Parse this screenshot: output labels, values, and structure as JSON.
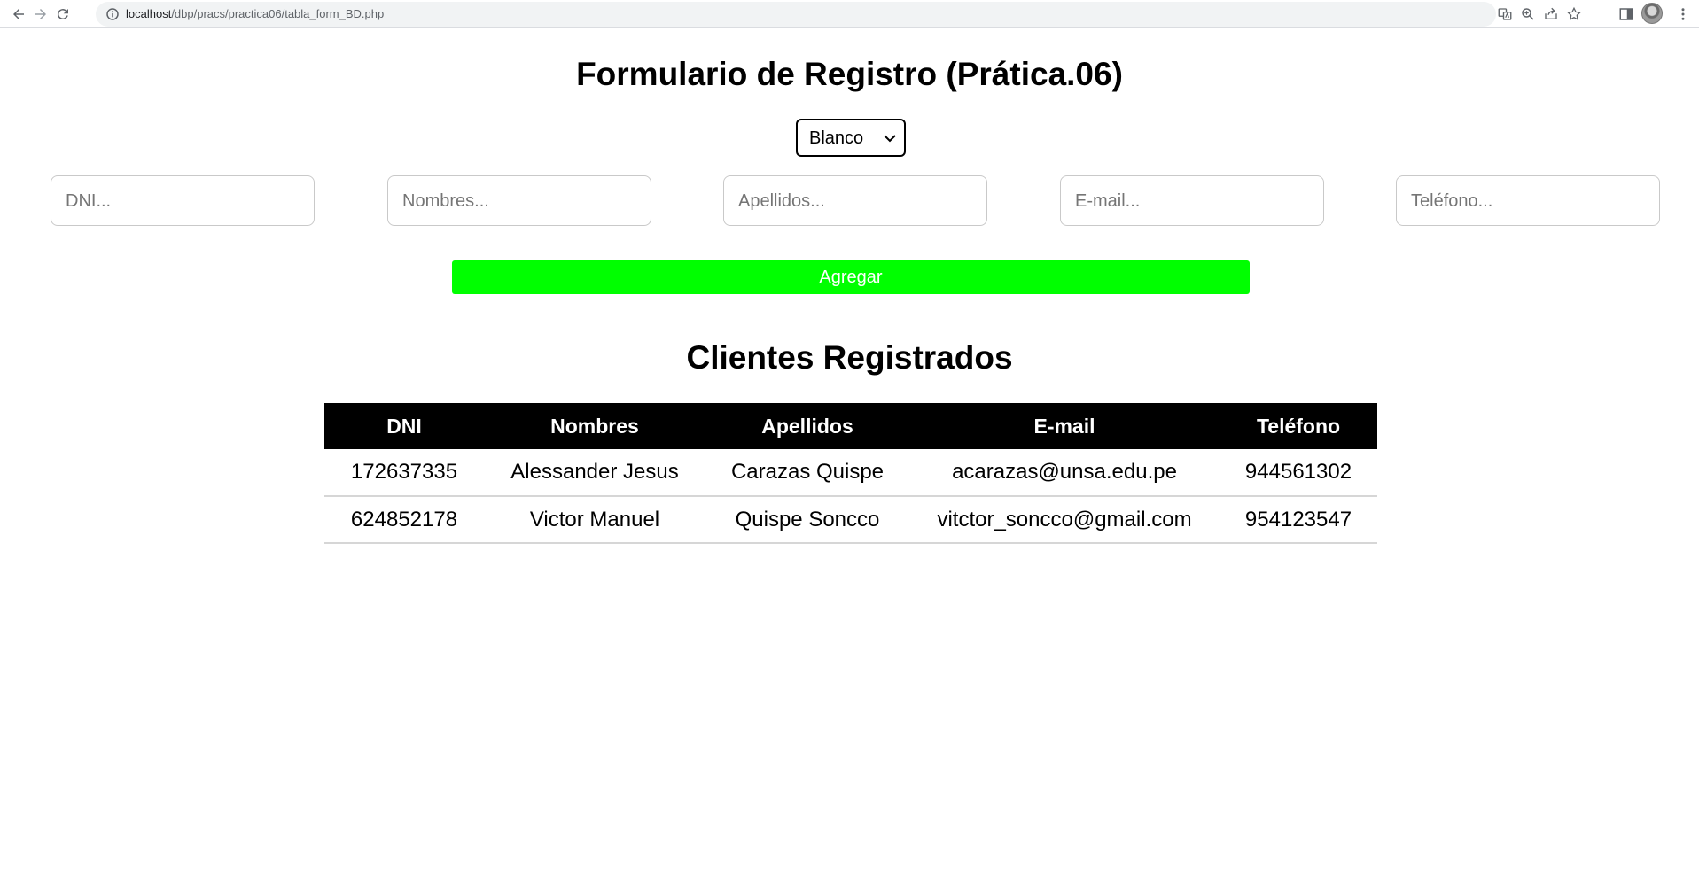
{
  "browser": {
    "url_host": "localhost",
    "url_path": "/dbp/pracs/practica06/tabla_form_BD.php"
  },
  "page": {
    "title": "Formulario de Registro (Prática.06)",
    "color_select": {
      "selected": "Blanco"
    },
    "inputs": [
      {
        "placeholder": "DNI..."
      },
      {
        "placeholder": "Nombres..."
      },
      {
        "placeholder": "Apellidos..."
      },
      {
        "placeholder": "E-mail..."
      },
      {
        "placeholder": "Teléfono..."
      }
    ],
    "add_button": "Agregar",
    "add_button_color": "#00ff00",
    "subtitle": "Clientes Registrados",
    "table": {
      "headers": [
        "DNI",
        "Nombres",
        "Apellidos",
        "E-mail",
        "Teléfono"
      ],
      "rows": [
        [
          "172637335",
          "Alessander Jesus",
          "Carazas Quispe",
          "acarazas@unsa.edu.pe",
          "944561302"
        ],
        [
          "624852178",
          "Victor Manuel",
          "Quispe Soncco",
          "vitctor_soncco@gmail.com",
          "954123547"
        ]
      ]
    }
  }
}
